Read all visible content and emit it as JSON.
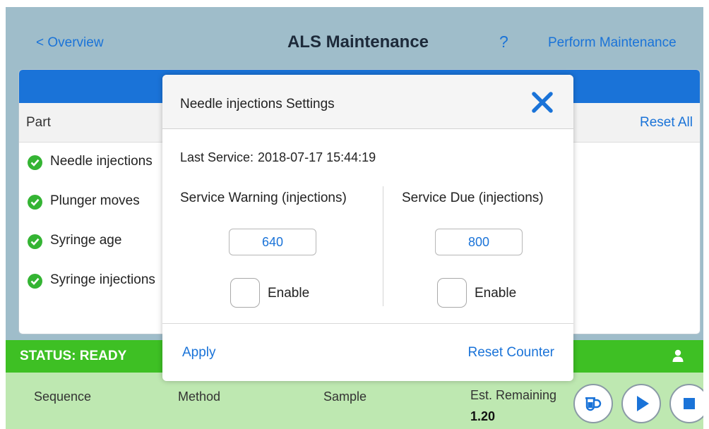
{
  "header": {
    "back_label": "< Overview",
    "title": "ALS Maintenance",
    "help_label": "?",
    "perform_label": "Perform Maintenance"
  },
  "table": {
    "column_part": "Part",
    "reset_all_label": "Reset All",
    "rows": [
      {
        "label": "Needle injections",
        "status": "ok"
      },
      {
        "label": "Plunger moves",
        "status": "ok"
      },
      {
        "label": "Syringe age",
        "status": "ok"
      },
      {
        "label": "Syringe injections",
        "status": "ok"
      }
    ]
  },
  "status": {
    "text": "STATUS: READY",
    "icon": "user-icon"
  },
  "run_bar": {
    "sequence_label": "Sequence",
    "method_label": "Method",
    "sample_label": "Sample",
    "remaining_label": "Est. Remaining",
    "remaining_value": "1.20",
    "buttons": [
      "single-injection-icon",
      "play-icon",
      "stop-icon"
    ]
  },
  "dialog": {
    "title": "Needle injections Settings",
    "last_service_label": "Last Service:",
    "last_service_value": "2018-07-17 15:44:19",
    "warning_title": "Service Warning (injections)",
    "warning_value": "640",
    "warning_enabled": false,
    "due_title": "Service Due (injections)",
    "due_value": "800",
    "due_enabled": false,
    "enable_label": "Enable",
    "apply_label": "Apply",
    "reset_counter_label": "Reset Counter"
  },
  "colors": {
    "accent": "#1a73d8",
    "status_ready": "#3ec024",
    "run_bar": "#bee8b1",
    "check": "#34b433",
    "screen_bg": "#9fbdca"
  }
}
